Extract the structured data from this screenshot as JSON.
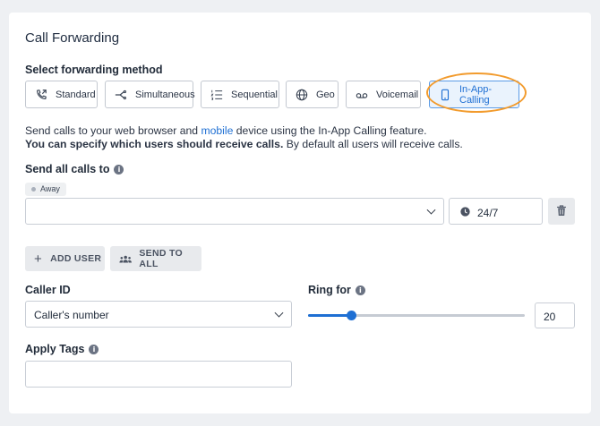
{
  "header": {
    "title": "Call Forwarding"
  },
  "method": {
    "label": "Select forwarding method",
    "options": [
      {
        "label": "Standard",
        "icon": "phone-forward-icon"
      },
      {
        "label": "Simultaneous",
        "icon": "branch-icon"
      },
      {
        "label": "Sequential",
        "icon": "ordered-list-icon"
      },
      {
        "label": "Geo",
        "icon": "globe-icon"
      },
      {
        "label": "Voicemail",
        "icon": "voicemail-icon"
      },
      {
        "label": "In-App-Calling",
        "icon": "mobile-icon",
        "selected": true
      }
    ]
  },
  "description": {
    "line1_prefix": "Send calls to your web browser and ",
    "line1_link": "mobile",
    "line1_suffix": " device using the In-App Calling feature.",
    "line2_bold": "You can specify which users should receive calls.",
    "line2_rest": " By default all users will receive calls."
  },
  "send_all": {
    "label": "Send all calls to",
    "status_badge": "Away",
    "user_select_value": "",
    "schedule_value": "24/7"
  },
  "actions": {
    "add_user": "ADD USER",
    "send_to_all": "SEND TO ALL"
  },
  "caller_id": {
    "label": "Caller ID",
    "value": "Caller's number"
  },
  "ring_for": {
    "label": "Ring for",
    "value": "20",
    "slider_fraction": 0.2
  },
  "tags": {
    "label": "Apply Tags",
    "value": ""
  },
  "colors": {
    "accent": "#1e6fd3",
    "highlight": "#f29b2d",
    "selected_bg": "#eaf3fd"
  }
}
